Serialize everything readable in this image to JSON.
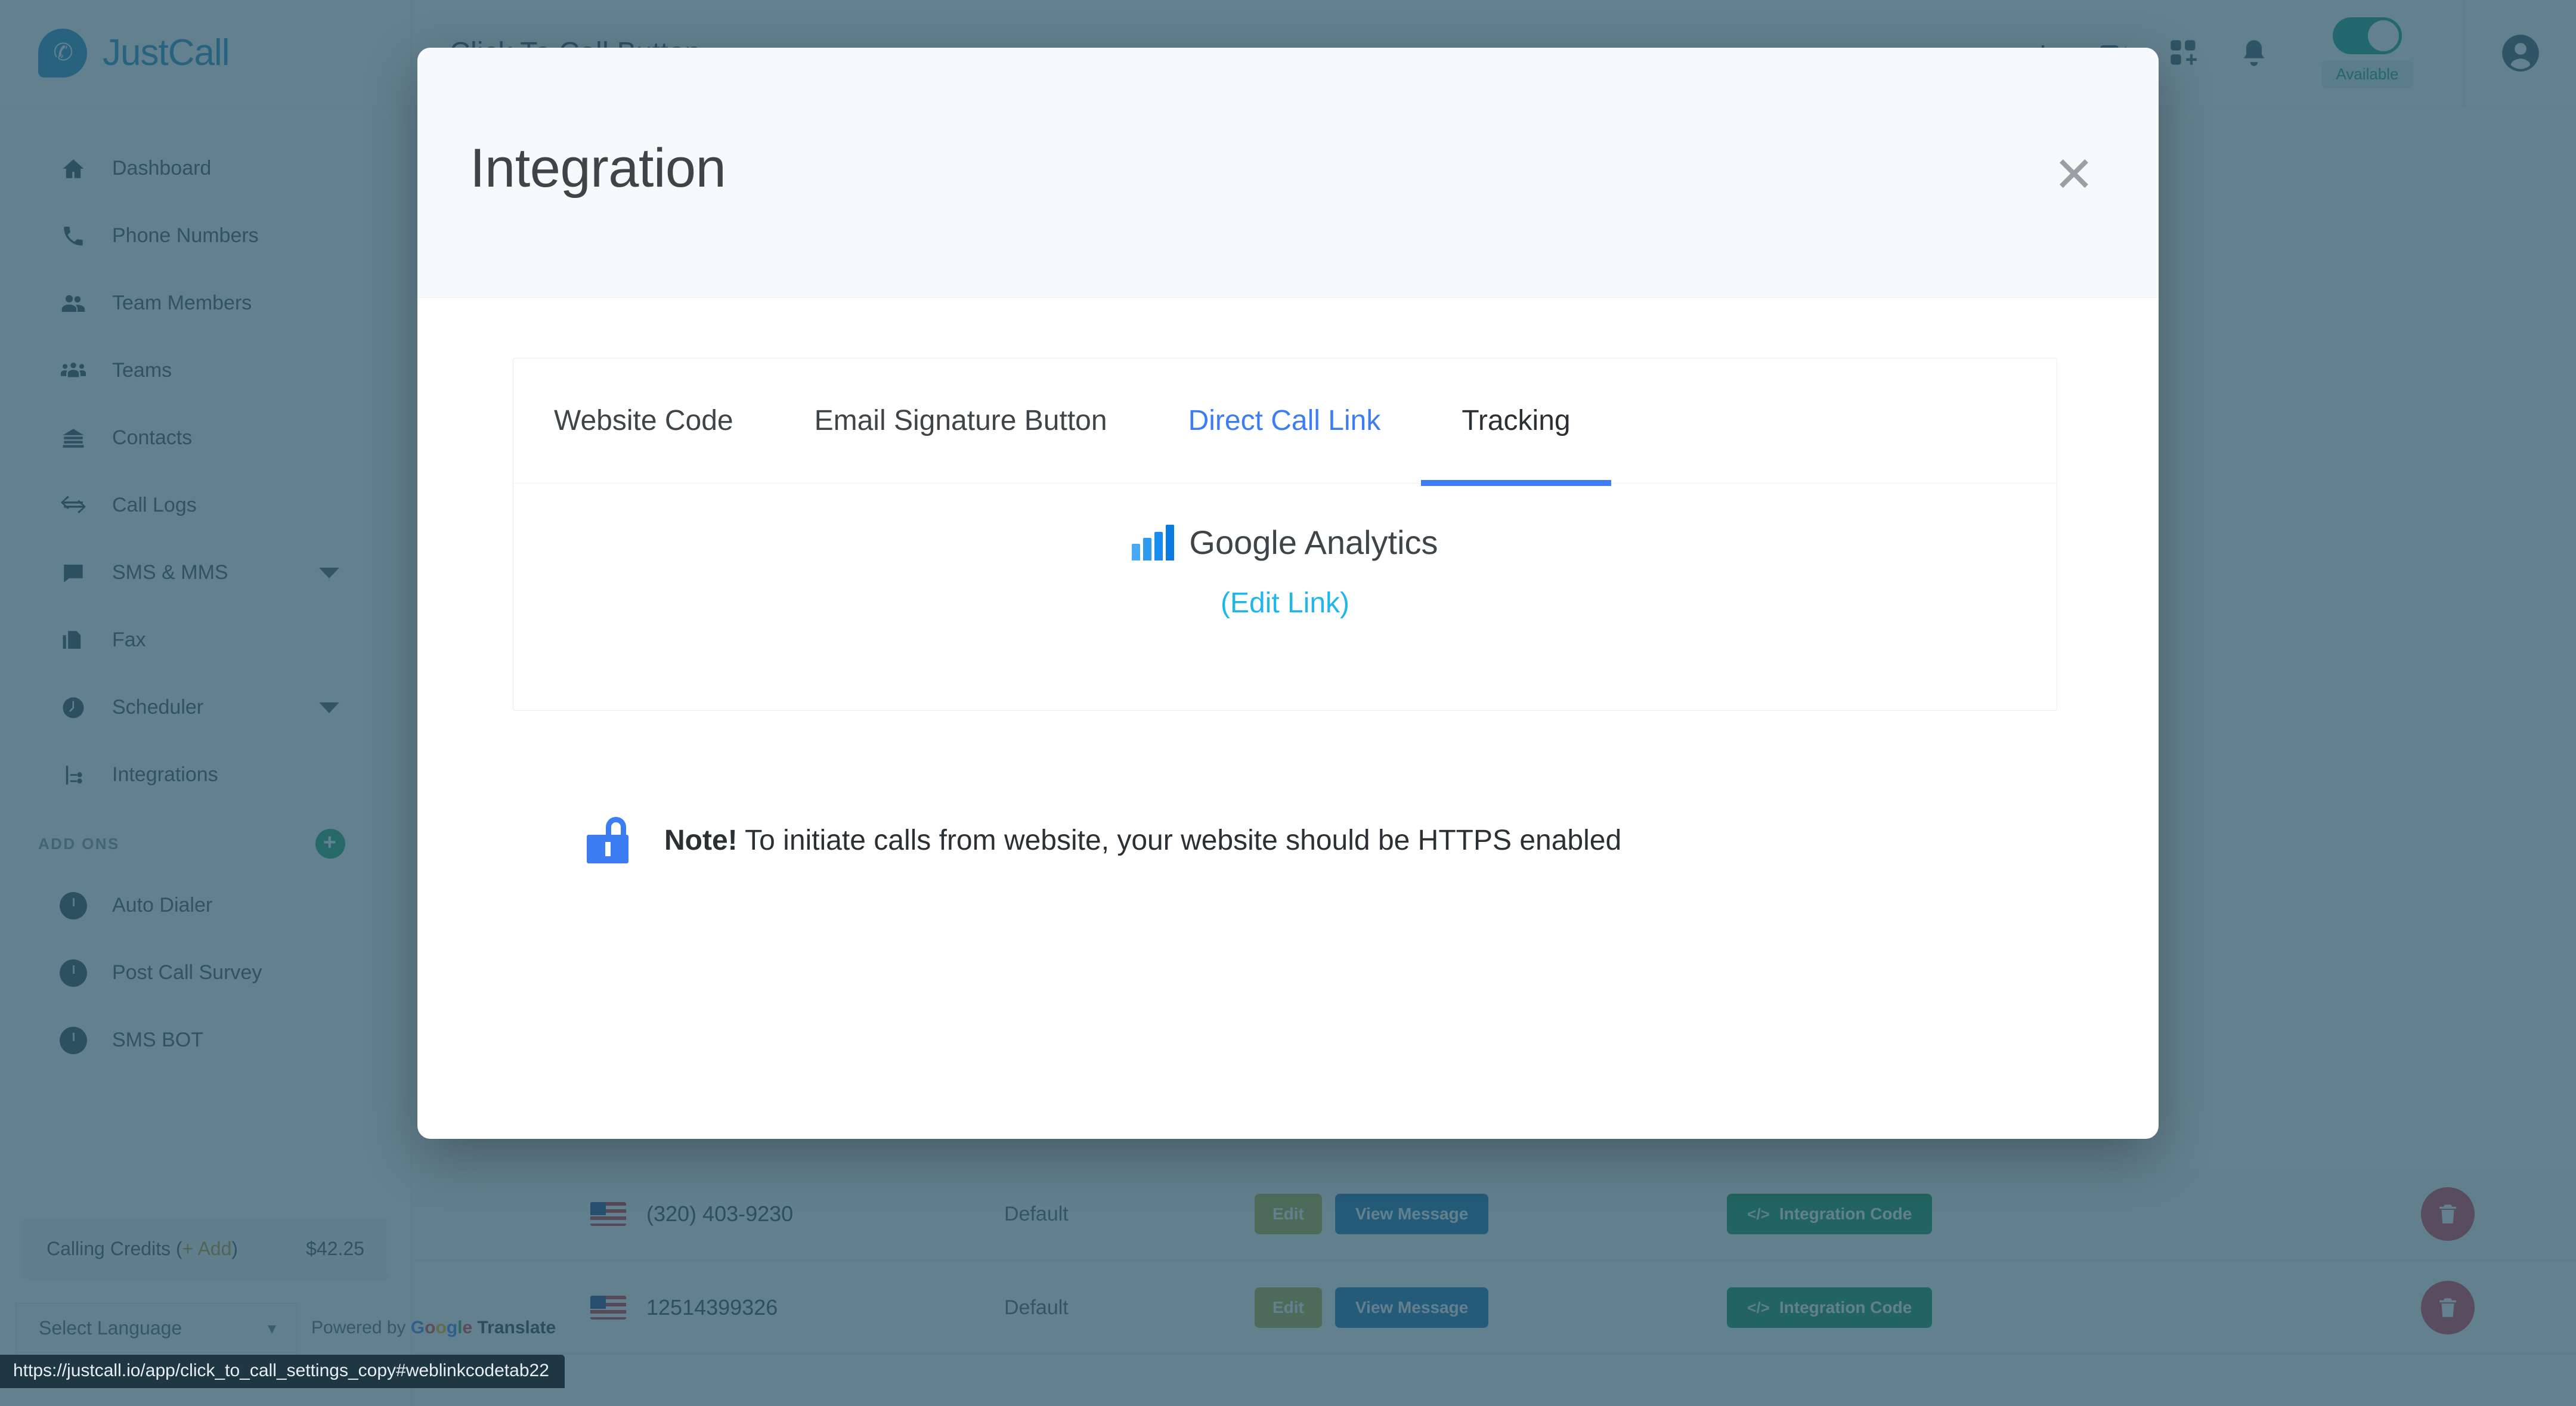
{
  "brand": {
    "name": "JustCall",
    "logo_icon": "phone-bubble-logo"
  },
  "sidebar": {
    "items": [
      {
        "label": "Dashboard",
        "icon": "home-icon",
        "caret": false
      },
      {
        "label": "Phone Numbers",
        "icon": "phone-icon",
        "caret": false
      },
      {
        "label": "Team Members",
        "icon": "users-icon",
        "caret": false
      },
      {
        "label": "Teams",
        "icon": "team-group-icon",
        "caret": false
      },
      {
        "label": "Contacts",
        "icon": "contacts-icon",
        "caret": false
      },
      {
        "label": "Call Logs",
        "icon": "exchange-arrows-icon",
        "caret": false
      },
      {
        "label": "SMS & MMS",
        "icon": "chat-bubble-icon",
        "caret": true
      },
      {
        "label": "Fax",
        "icon": "fax-icon",
        "caret": false
      },
      {
        "label": "Scheduler",
        "icon": "clock-icon",
        "caret": true
      },
      {
        "label": "Integrations",
        "icon": "share-nodes-icon",
        "caret": false
      }
    ],
    "addons_header": "ADD ONS",
    "addons_add_icon": "plus-circle-icon",
    "addons": [
      {
        "label": "Auto Dialer",
        "icon": "clock-icon"
      },
      {
        "label": "Post Call Survey",
        "icon": "clock-icon"
      },
      {
        "label": "SMS BOT",
        "icon": "clock-icon"
      }
    ],
    "credits": {
      "label": "Calling Credits (",
      "add_label": "+ Add",
      "label_end": ")",
      "amount": "$42.25"
    },
    "translate": {
      "select_value": "Select Language",
      "chevron_icon": "chevron-down-icon",
      "powered_by": "Powered by",
      "google": [
        "G",
        "o",
        "o",
        "g",
        "l",
        "e"
      ],
      "translate_word": "Translate"
    }
  },
  "topbar": {
    "page_title": "Click To Call Button",
    "icons": [
      {
        "name": "info-icon"
      },
      {
        "name": "video-call-icon"
      },
      {
        "name": "apps-grid-plus-icon"
      },
      {
        "name": "bell-icon"
      }
    ],
    "availability": {
      "status_label": "Available",
      "toggle_on": true
    },
    "avatar_icon": "user-avatar-icon"
  },
  "background_table": {
    "rows": [
      {
        "flag": "us-flag-icon",
        "number": "(320) 403-9230",
        "type": "Default",
        "edit_label": "Edit",
        "view_message_label": "View Message",
        "integration_label": "Integration Code",
        "delete_icon": "trash-icon"
      },
      {
        "flag": "us-flag-icon",
        "number": "12514399326",
        "type": "Default",
        "edit_label": "Edit",
        "view_message_label": "View Message",
        "integration_label": "Integration Code",
        "delete_icon": "trash-icon"
      }
    ]
  },
  "modal": {
    "title": "Integration",
    "close_icon": "close-icon",
    "tabs": [
      {
        "label": "Website Code",
        "state": "normal"
      },
      {
        "label": "Email Signature Button",
        "state": "normal"
      },
      {
        "label": "Direct Call Link",
        "state": "link"
      },
      {
        "label": "Tracking",
        "state": "active"
      }
    ],
    "panel": {
      "analytics_icon": "bar-chart-icon",
      "analytics_label": "Google Analytics",
      "edit_link_label": "(Edit Link)"
    },
    "note": {
      "lock_icon": "lock-icon",
      "prefix": "Note!",
      "text": " To initiate calls from website, your website should be HTTPS enabled"
    }
  },
  "status_bar": {
    "url": "https://justcall.io/app/click_to_call_settings_copy#weblinkcodetab22"
  },
  "colors": {
    "brand_blue": "#2a93c6",
    "accent_blue": "#3c7df4",
    "link_cyan": "#20b7e8",
    "available_green": "#17a08b",
    "integration_green": "#189b5d",
    "edit_olive": "#b2b545",
    "view_message_blue": "#1f7bb5",
    "delete_red": "#d94452",
    "overlay_tint": "#274f63"
  }
}
